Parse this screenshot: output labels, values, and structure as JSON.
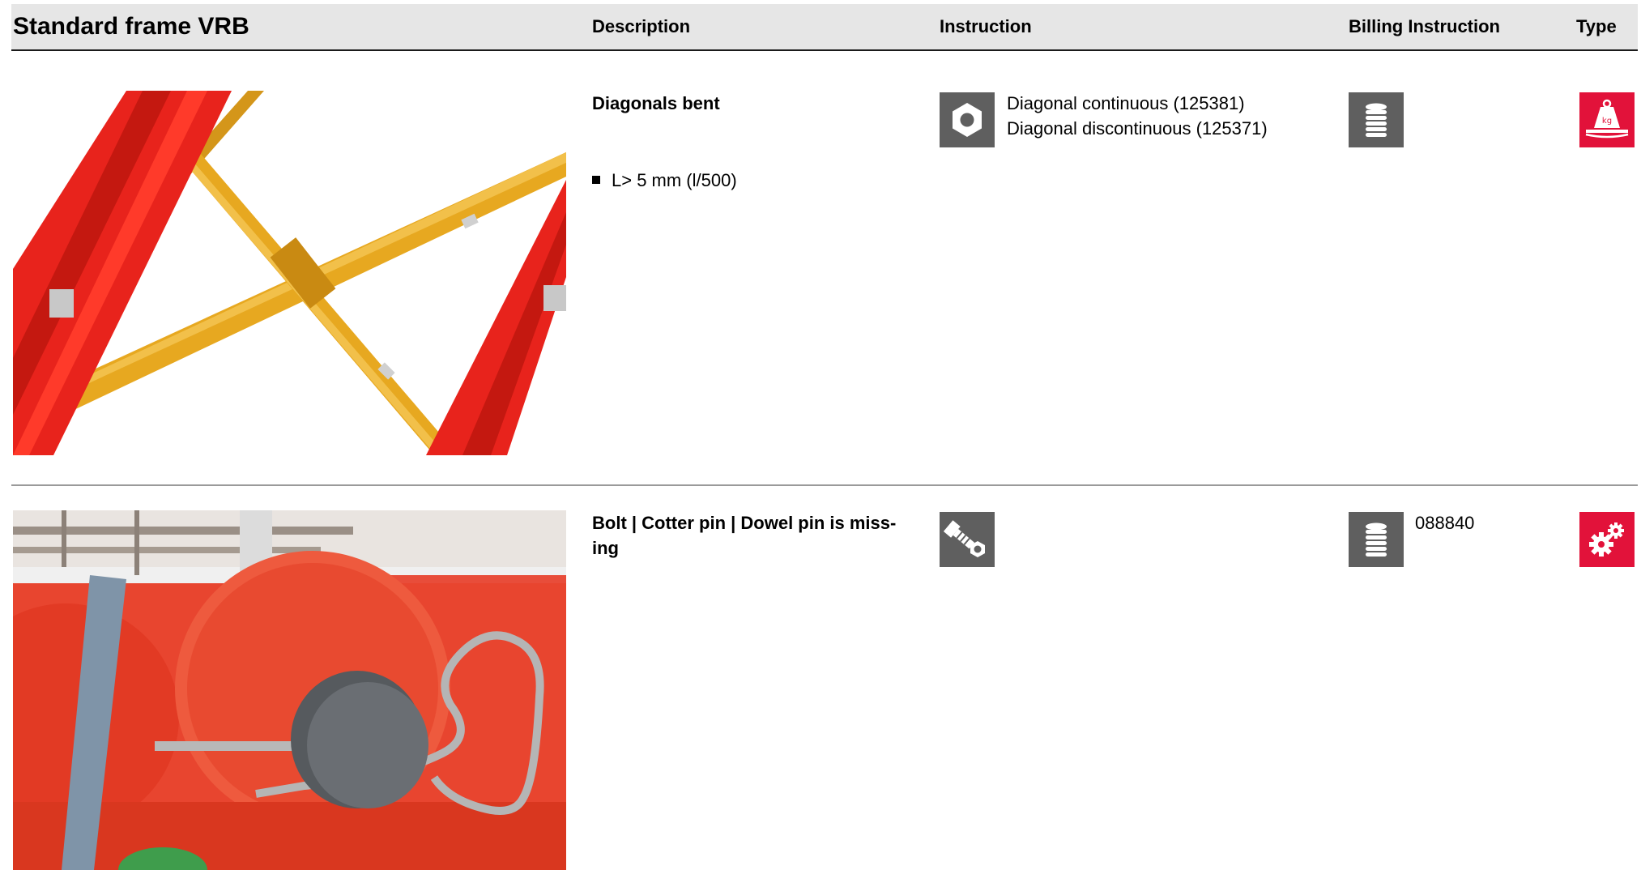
{
  "header": {
    "title": "Standard frame VRB",
    "col_description": "Description",
    "col_instruction": "Instruction",
    "col_billing": "Billing Instruction",
    "col_type": "Type"
  },
  "rows": [
    {
      "description_title": "Diagonals bent",
      "criteria": [
        "L> 5 mm (l/500)"
      ],
      "instruction_icon": "nut-icon",
      "instruction_lines": [
        "Diagonal continuous (125381)",
        "Diagonal discontinuous (125371)"
      ],
      "billing_icon": "coin-stack-icon",
      "billing_text": "",
      "type_icon": "weight-kg-icon"
    },
    {
      "description_title_line1": "Bolt | Cotter pin | Dowel pin is miss-",
      "description_title_line2": "ing",
      "instruction_icon": "bolt-and-nut-icon",
      "billing_icon": "coin-stack-icon",
      "billing_text": "088840",
      "type_icon": "gears-icon"
    }
  ],
  "colors": {
    "header_bg": "#e6e6e6",
    "icon_gray": "#5f5f5f",
    "type_red": "#e2123a",
    "frame_red": "#e8231c",
    "diagonal_yellow": "#e2a21e"
  }
}
